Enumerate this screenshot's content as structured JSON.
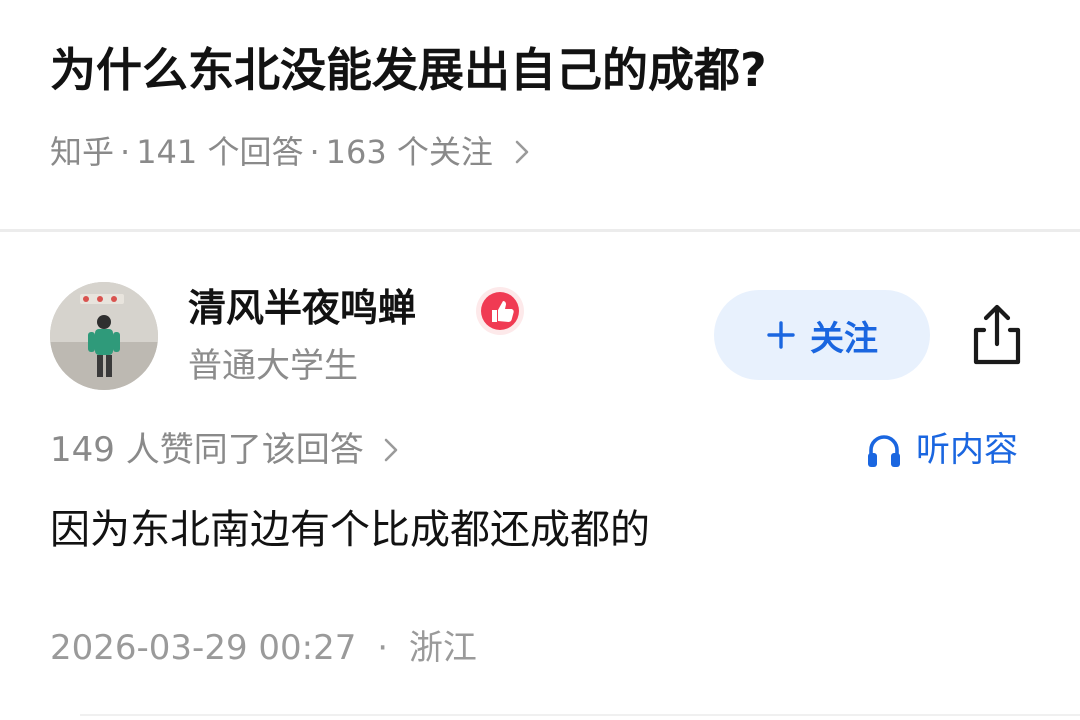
{
  "question": {
    "title": "为什么东北没能发展出自己的成都?",
    "source": "知乎",
    "answers_count": "141 个回答",
    "followers_count": "163 个关注",
    "separator": "·"
  },
  "author": {
    "name": "清风半夜鸣蝉",
    "bio": "普通大学生",
    "badge_icon": "thumbs-up-badge-icon",
    "follow_label": "关注",
    "follow_color": "#1a66e0",
    "follow_bg": "#e8f1fd"
  },
  "answer": {
    "upvote_text": "149 人赞同了该回答",
    "listen_label": "听内容",
    "content": "因为东北南边有个比成都还成都的",
    "datetime": "2026-03-29 00:27",
    "separator": "·",
    "location": "浙江"
  }
}
